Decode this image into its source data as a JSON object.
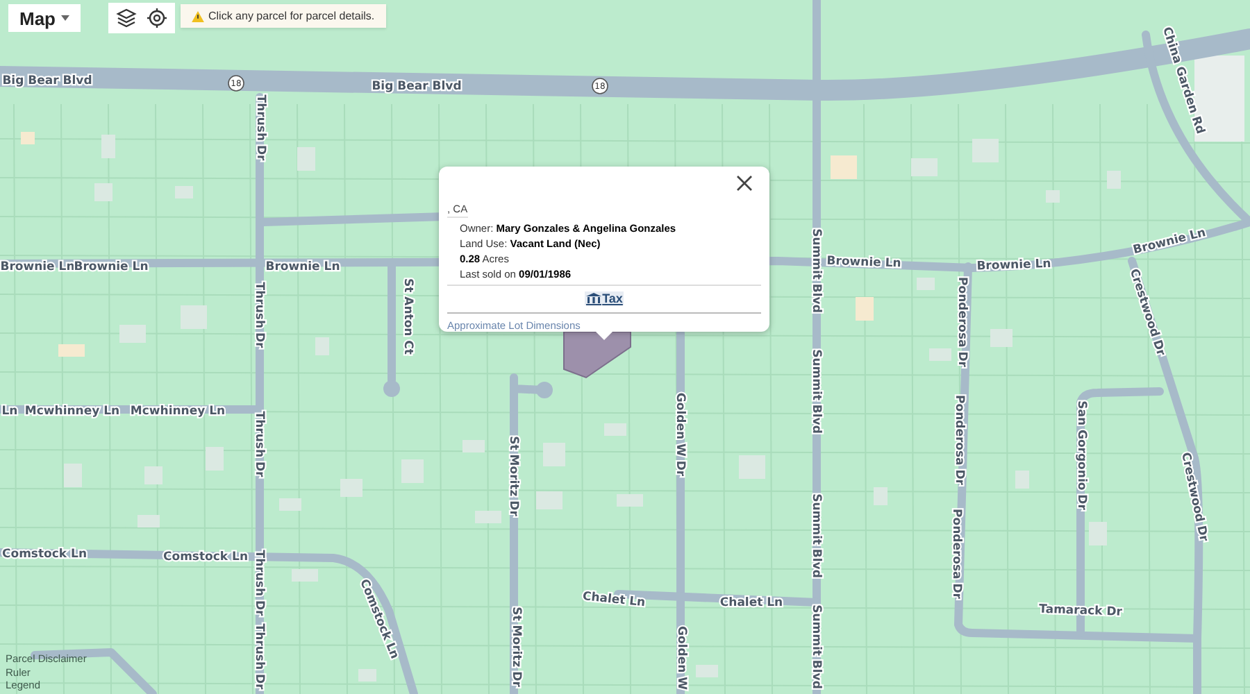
{
  "toolbar": {
    "map_menu": "Map",
    "notice": "Click any parcel for parcel details."
  },
  "map": {
    "route_shields": [
      "18",
      "18"
    ],
    "street_labels": [
      "Big Bear Blvd",
      "Big Bear Blvd",
      "Thrush Dr",
      "China Garden Rd",
      "Brownie Ln",
      "Brownie Ln",
      "Brownie Ln",
      "Brownie Ln",
      "Brownie Ln",
      "Brownie Ln",
      "St Anton Ct",
      "Ln",
      "Mcwhinney Ln",
      "Mcwhinney Ln",
      "Thrush Dr",
      "Thrush Dr",
      "Thrush Dr",
      "Thrush Dr",
      "Comstock Ln",
      "Comstock Ln",
      "Comstock Ln",
      "St Moritz Dr",
      "St Moritz Dr",
      "Golden W Dr",
      "Golden W",
      "Chalet Ln",
      "Chalet Ln",
      "Summit Blvd",
      "Summit Blvd",
      "Summit Blvd",
      "Summit Blvd",
      "Ponderosa Dr",
      "Ponderosa Dr",
      "Ponderosa Dr",
      "San Gorgonio Dr",
      "Crestwood Dr",
      "Crestwood Dr",
      "Tamarack Dr"
    ]
  },
  "popup": {
    "address": ", CA",
    "details": [
      "Owner: **Mary Gonzales & Angelina Gonzales**",
      "Land Use: **Vacant Land (Nec)**",
      "**0.28** Acres",
      "Last sold on **09/01/1986**"
    ],
    "tax_link": "Tax",
    "lot_link": "Approximate Lot Dimensions"
  },
  "footer_links": [
    "Parcel Disclaimer",
    "Ruler",
    "Legend"
  ]
}
